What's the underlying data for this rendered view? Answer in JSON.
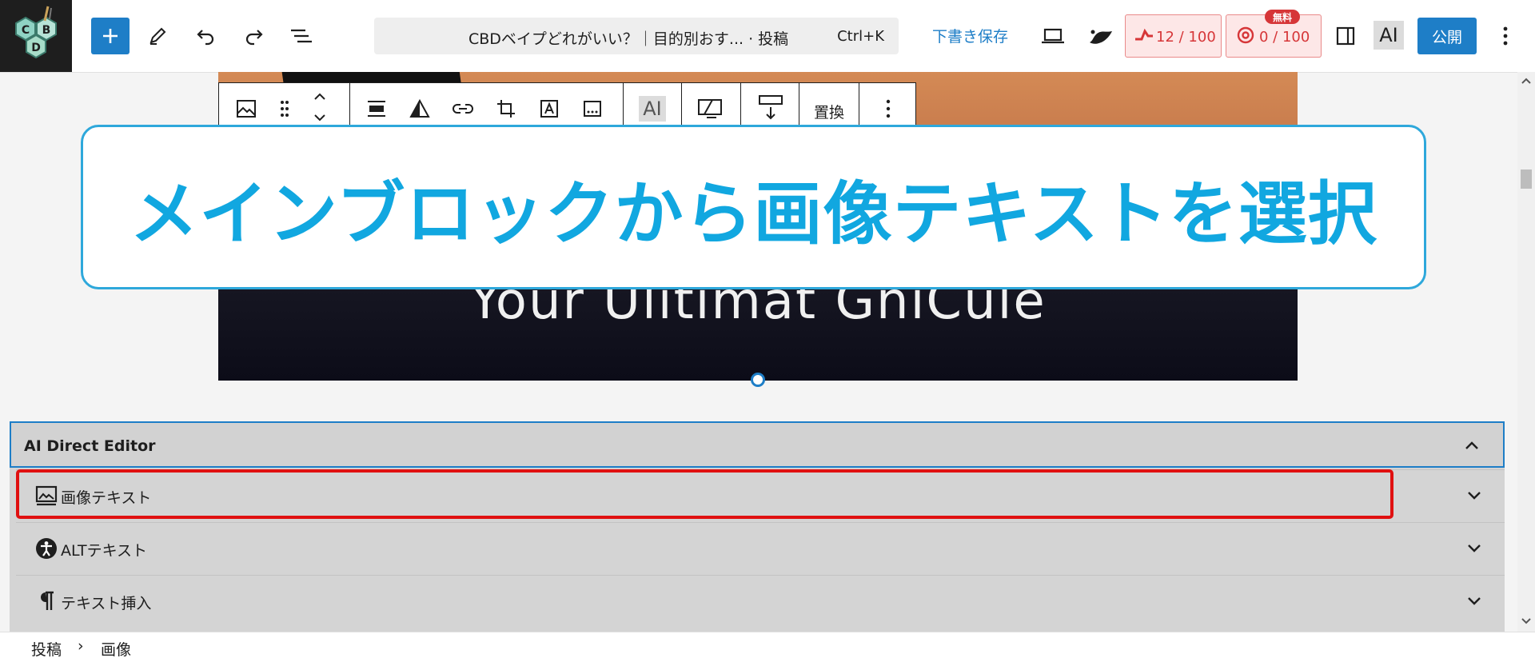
{
  "topbar": {
    "logo_letters": "CBD",
    "add_label": "+",
    "command": {
      "title": "CBDベイプどれがいい？｜目的別おす... · 投稿",
      "shortcut": "Ctrl+K"
    },
    "save_draft": "下書き保存",
    "counter1": "12 / 100",
    "counter2": "0 / 100",
    "free_badge": "無料",
    "ai_label": "AI",
    "publish": "公開"
  },
  "toolbar": {
    "ai_label": "AI",
    "replace_label": "置換"
  },
  "canvas": {
    "image_text": "Your Ulitimat GniCule"
  },
  "banner": {
    "text": "メインブロックから画像テキストを選択"
  },
  "panel": {
    "title": "AI Direct Editor",
    "rows": [
      {
        "label": "画像テキスト",
        "icon": "image-text-icon"
      },
      {
        "label": "ALTテキスト",
        "icon": "accessibility-icon"
      },
      {
        "label": "テキスト挿入",
        "icon": "paragraph-icon"
      }
    ]
  },
  "breadcrumb": {
    "items": [
      "投稿",
      "画像"
    ],
    "separator": "›"
  },
  "colors": {
    "accent": "#1e7ec7",
    "banner_text": "#11a7e0",
    "highlight": "#e01010",
    "counter_text": "#d63638"
  }
}
